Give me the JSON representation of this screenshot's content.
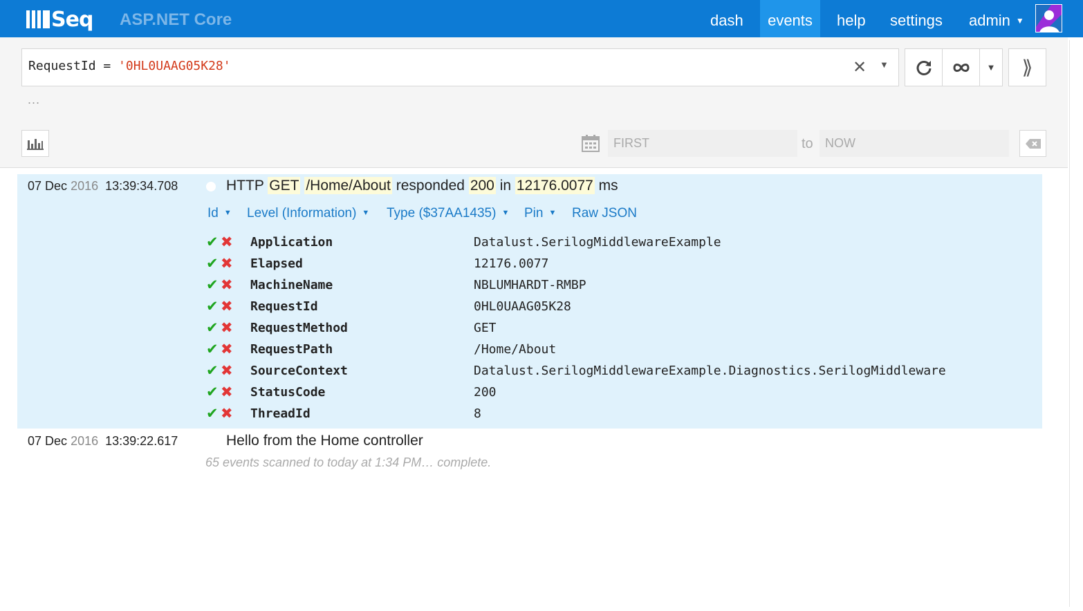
{
  "header": {
    "logo_text": "Seq",
    "instance_title": "ASP.NET Core",
    "nav": [
      "dash",
      "events",
      "help",
      "settings"
    ],
    "active_nav": "events",
    "user": "admin"
  },
  "query": {
    "filter_prefix": "RequestId = ",
    "filter_value": "'0HL0UAAG05K28'",
    "more": "...",
    "date_from_placeholder": "FIRST",
    "date_to_label": "to",
    "date_to_placeholder": "NOW"
  },
  "events": [
    {
      "date": "07 Dec",
      "year": "2016",
      "time": "13:39:34.708",
      "message": {
        "p1": "HTTP ",
        "method": "GET",
        "p2": " ",
        "path": "/Home/About",
        "p3": " responded ",
        "status": "200",
        "p4": " in ",
        "elapsed": "12176.0077",
        "p5": " ms"
      },
      "actions": {
        "id": "Id",
        "level": "Level (Information)",
        "type": "Type ($37AA1435)",
        "pin": "Pin",
        "raw": "Raw JSON"
      },
      "properties": [
        {
          "name": "Application",
          "value": "Datalust.SerilogMiddlewareExample"
        },
        {
          "name": "Elapsed",
          "value": "12176.0077"
        },
        {
          "name": "MachineName",
          "value": "NBLUMHARDT-RMBP"
        },
        {
          "name": "RequestId",
          "value": "0HL0UAAG05K28"
        },
        {
          "name": "RequestMethod",
          "value": "GET"
        },
        {
          "name": "RequestPath",
          "value": "/Home/About"
        },
        {
          "name": "SourceContext",
          "value": "Datalust.SerilogMiddlewareExample.Diagnostics.SerilogMiddleware"
        },
        {
          "name": "StatusCode",
          "value": "200"
        },
        {
          "name": "ThreadId",
          "value": "8"
        }
      ]
    },
    {
      "date": "07 Dec",
      "year": "2016",
      "time": "13:39:22.617",
      "message_text": "Hello from the Home controller"
    }
  ],
  "status_text": "65 events scanned to today at 1:34 PM… complete.",
  "icons": {
    "check": "✔",
    "cross": "✖"
  },
  "colors": {
    "header_bg": "#0d7bd5",
    "active_nav_bg": "#1f95ea",
    "selected_event_bg": "#e0f2fc",
    "token_highlight": "#fdfbd9",
    "link_blue": "#1a7ac7",
    "check_green": "#1fa51f",
    "cross_red": "#e23636",
    "filter_string_red": "#d33a1a"
  }
}
